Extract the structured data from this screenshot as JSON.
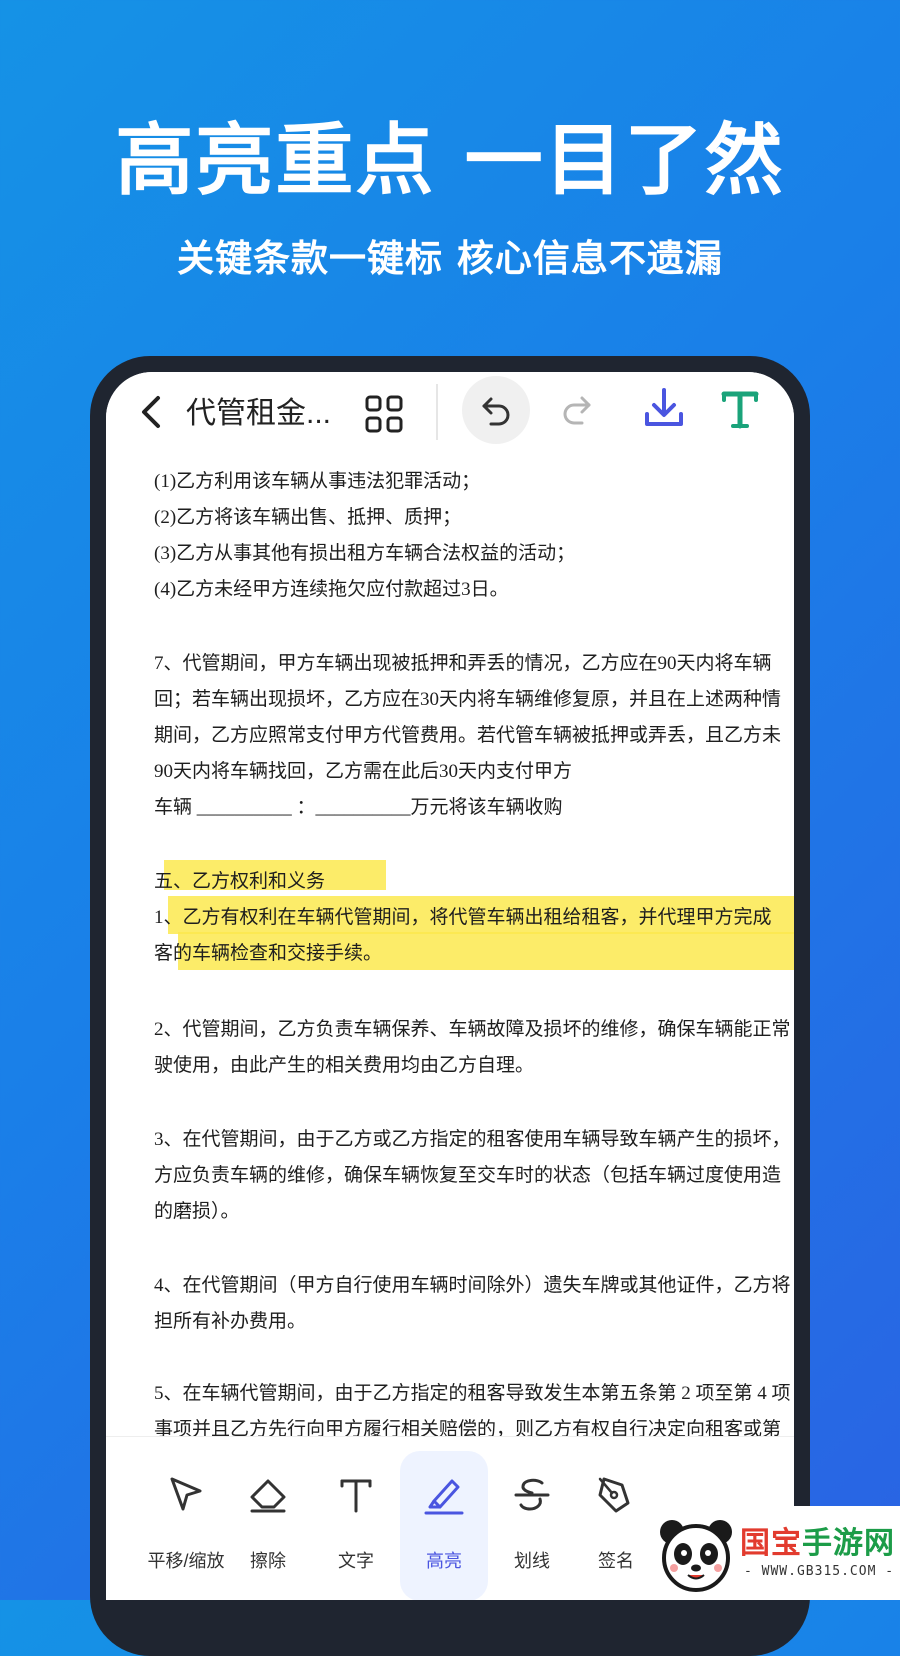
{
  "headline": "高亮重点 一目了然",
  "subline": "关键条款一键标 核心信息不遗漏",
  "topbar": {
    "title": "代管租金...",
    "icons": [
      "back-icon",
      "grid-icon",
      "undo-icon",
      "redo-icon",
      "download-icon",
      "text-icon"
    ]
  },
  "document": {
    "lines": [
      "(1)乙方利用该车辆从事违法犯罪活动；",
      "(2)乙方将该车辆出售、抵押、质押；",
      "(3)乙方从事其他有损出租方车辆合法权益的活动；",
      "(4)乙方未经甲方连续拖欠应付款超过3日。",
      "7、代管期间，甲方车辆出现被抵押和弄丢的情况，乙方应在90天内将车辆",
      "回；若车辆出现损坏，乙方应在30天内将车辆维修复原，并且在上述两种情",
      "期间，乙方应照常支付甲方代管费用。若代管车辆被抵押或弄丢，且乙方未",
      "90天内将车辆找回，乙方需在此后30天内支付甲方",
      "车辆 __________ ：__________万元将该车辆收购",
      "五、乙方权利和义务",
      "1、乙方有权利在车辆代管期间，将代管车辆出租给租客，并代理甲方完成",
      "客的车辆检查和交接手续。",
      "2、代管期间，乙方负责车辆保养、车辆故障及损坏的维修，确保车辆能正常",
      "驶使用，由此产生的相关费用均由乙方自理。",
      "3、在代管期间，由于乙方或乙方指定的租客使用车辆导致车辆产生的损坏，",
      "方应负责车辆的维修，确保车辆恢复至交车时的状态（包括车辆过度使用造",
      "的磨损）。",
      "4、在代管期间（甲方自行使用车辆时间除外）遗失车牌或其他证件，乙方将",
      "担所有补办费用。",
      "5、在车辆代管期间，由于乙方指定的租客导致发生本第五条第 2 项至第 4 项",
      "事项并且乙方先行向甲方履行相关赔偿的，则乙方有权自行决定向租客或第"
    ]
  },
  "tools": [
    {
      "label": "平移/缩放",
      "icon": "cursor-icon"
    },
    {
      "label": "擦除",
      "icon": "eraser-icon"
    },
    {
      "label": "文字",
      "icon": "text-icon"
    },
    {
      "label": "高亮",
      "icon": "highlighter-icon"
    },
    {
      "label": "划线",
      "icon": "strikethrough-icon"
    },
    {
      "label": "签名",
      "icon": "signature-pen-icon"
    }
  ],
  "watermark": {
    "brand_part1": "国宝",
    "brand_part2": "手游网",
    "url": "- WWW.GB315.COM -"
  },
  "colors": {
    "background_start": "#1592e6",
    "background_end": "#2a63e3",
    "highlight": "#fbe94f",
    "accent": "#4a55e0",
    "text_tool_green": "#1aa37a"
  }
}
